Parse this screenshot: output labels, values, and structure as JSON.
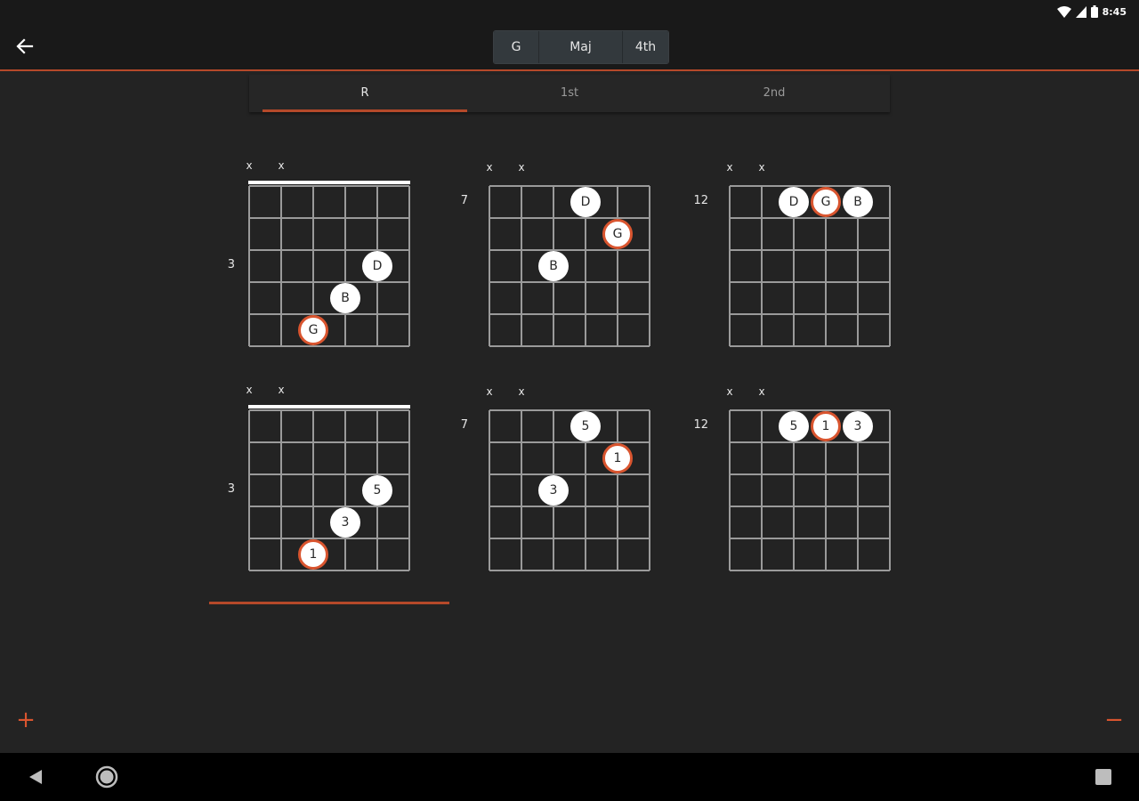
{
  "status_bar": {
    "time": "8:45"
  },
  "toolbar": {
    "selector": [
      {
        "label": "G",
        "name": "key-selector-button"
      },
      {
        "label": "Maj",
        "name": "chord-quality-selector-button"
      },
      {
        "label": "4th",
        "name": "string-set-selector-button"
      }
    ]
  },
  "tabs": [
    {
      "label": "R",
      "active": true
    },
    {
      "label": "1st",
      "active": false
    },
    {
      "label": "2nd",
      "active": false
    }
  ],
  "icons": {
    "back": "arrow-left-icon",
    "wifi": "wifi-icon",
    "signal": "cell-signal-icon",
    "battery": "battery-icon",
    "zoom_in": "plus-icon",
    "zoom_out": "minus-icon",
    "nav_back": "triangle-back-icon",
    "nav_home": "circle-home-icon",
    "nav_recents": "square-recents-icon"
  },
  "controls": {
    "zoom_in": "+",
    "zoom_out": "−"
  },
  "colors": {
    "accent": "#d9552f",
    "divider": "#b5492a",
    "background": "#232323",
    "bar": "#191919"
  },
  "diagrams": [
    {
      "row": 0,
      "col": 0,
      "fret_label": "3",
      "nut": true,
      "muted": [
        "x",
        "x"
      ],
      "dots": [
        {
          "string": 4,
          "fret": 3,
          "label": "D",
          "root": false
        },
        {
          "string": 3,
          "fret": 4,
          "label": "B",
          "root": false
        },
        {
          "string": 2,
          "fret": 5,
          "label": "G",
          "root": true
        }
      ]
    },
    {
      "row": 0,
      "col": 1,
      "fret_label": "7",
      "nut": false,
      "muted": [
        "x",
        "x"
      ],
      "dots": [
        {
          "string": 3,
          "fret": 1,
          "label": "D",
          "root": false
        },
        {
          "string": 4,
          "fret": 2,
          "label": "G",
          "root": true
        },
        {
          "string": 2,
          "fret": 3,
          "label": "B",
          "root": false
        }
      ]
    },
    {
      "row": 0,
      "col": 2,
      "fret_label": "12",
      "nut": false,
      "muted": [
        "x",
        "x"
      ],
      "dots": [
        {
          "string": 2,
          "fret": 1,
          "label": "D",
          "root": false
        },
        {
          "string": 3,
          "fret": 1,
          "label": "G",
          "root": true
        },
        {
          "string": 4,
          "fret": 1,
          "label": "B",
          "root": false
        }
      ]
    },
    {
      "row": 1,
      "col": 0,
      "fret_label": "3",
      "nut": true,
      "muted": [
        "x",
        "x"
      ],
      "dots": [
        {
          "string": 4,
          "fret": 3,
          "label": "5",
          "root": false
        },
        {
          "string": 3,
          "fret": 4,
          "label": "3",
          "root": false
        },
        {
          "string": 2,
          "fret": 5,
          "label": "1",
          "root": true
        }
      ]
    },
    {
      "row": 1,
      "col": 1,
      "fret_label": "7",
      "nut": false,
      "muted": [
        "x",
        "x"
      ],
      "dots": [
        {
          "string": 3,
          "fret": 1,
          "label": "5",
          "root": false
        },
        {
          "string": 4,
          "fret": 2,
          "label": "1",
          "root": true
        },
        {
          "string": 2,
          "fret": 3,
          "label": "3",
          "root": false
        }
      ]
    },
    {
      "row": 1,
      "col": 2,
      "fret_label": "12",
      "nut": false,
      "muted": [
        "x",
        "x"
      ],
      "dots": [
        {
          "string": 2,
          "fret": 1,
          "label": "5",
          "root": false
        },
        {
          "string": 3,
          "fret": 1,
          "label": "1",
          "root": true
        },
        {
          "string": 4,
          "fret": 1,
          "label": "3",
          "root": false
        }
      ]
    }
  ]
}
